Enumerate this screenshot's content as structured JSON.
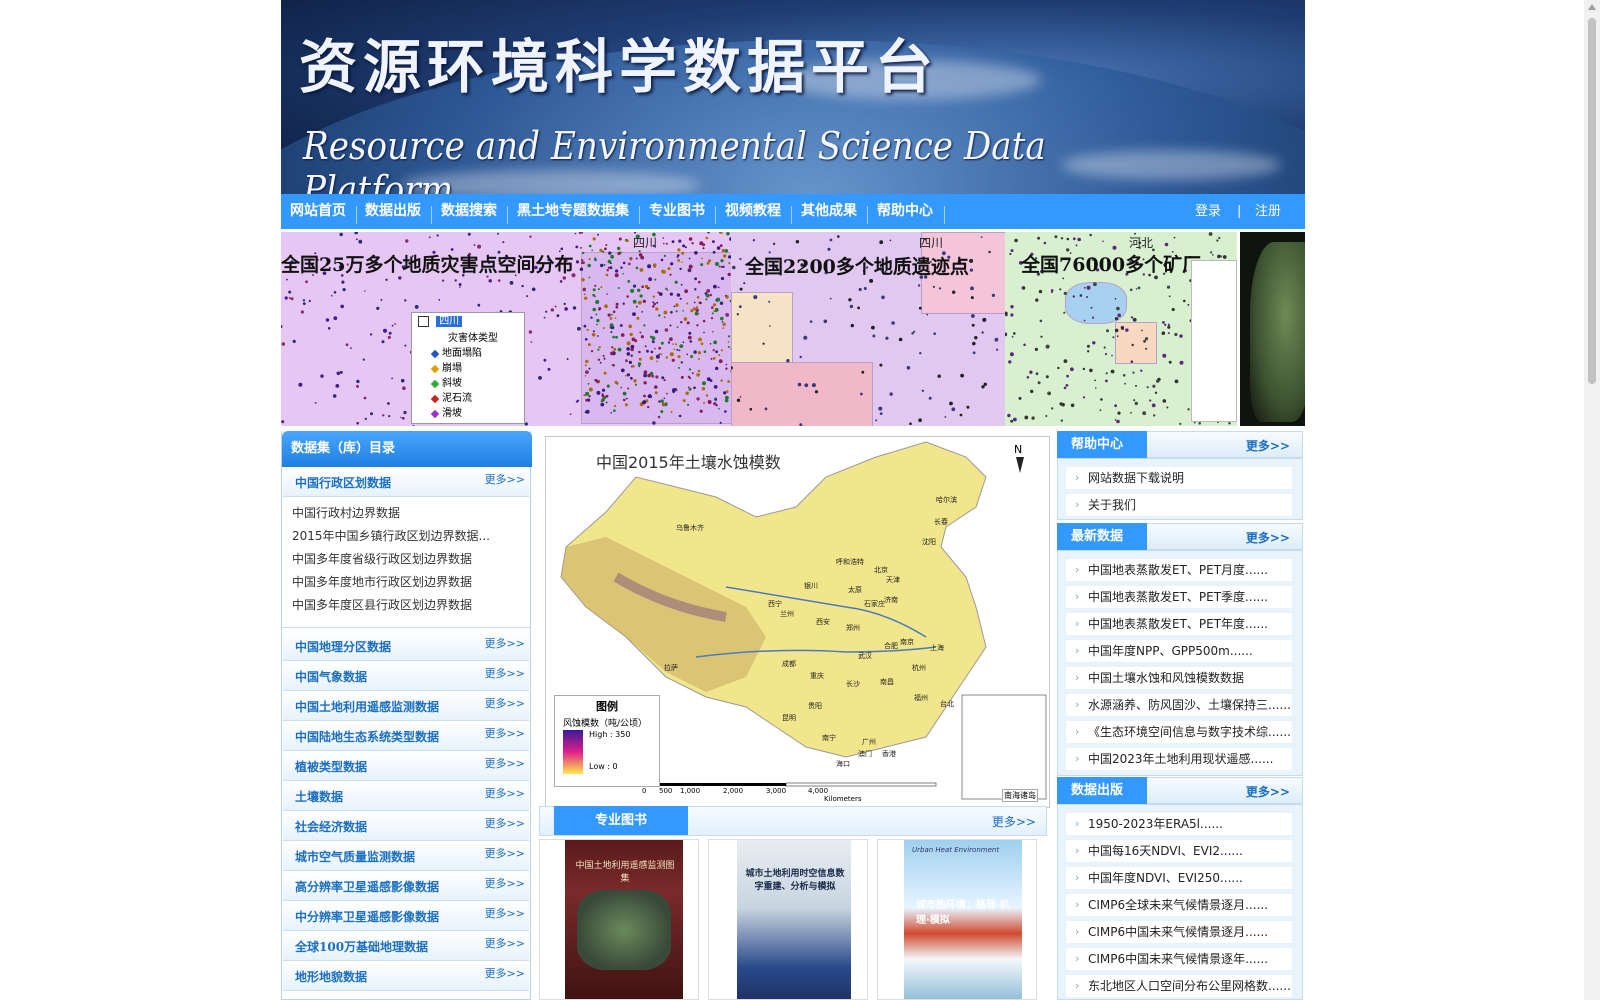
{
  "banner": {
    "title_cn": "资源环境科学数据平台",
    "title_en": "Resource and Environmental Science Data Platform"
  },
  "nav": {
    "items": [
      "网站首页",
      "数据出版",
      "数据搜索",
      "黑土地专题数据集",
      "专业图书",
      "视频教程",
      "其他成果",
      "帮助中心"
    ],
    "login": "登录",
    "divider": "|",
    "register": "注册"
  },
  "slider": {
    "slide1": {
      "title": "全国25万多个地质灾害点空间分布",
      "province": "四川",
      "legend_province": "四川",
      "legend_type": "灾害体类型",
      "legend_items": [
        "地面塌陷",
        "崩塌",
        "斜坡",
        "泥石流",
        "滑坡"
      ]
    },
    "slide2": {
      "title": "全国2200多个地质遗迹点",
      "province": "四川"
    },
    "slide3": {
      "title": "全国76000多个矿厂",
      "province": "河北"
    }
  },
  "left": {
    "header": "数据集（库）目录",
    "first_category": "中国行政区划数据",
    "more": "更多>>",
    "sub_items": [
      "中国行政村边界数据",
      "2015年中国乡镇行政区划边界数据...",
      "中国多年度省级行政区划边界数据",
      "中国多年度地市行政区划边界数据",
      "中国多年度区县行政区划边界数据"
    ],
    "categories": [
      "中国地理分区数据",
      "中国气象数据",
      "中国土地利用遥感监测数据",
      "中国陆地生态系统类型数据",
      "植被类型数据",
      "土壤数据",
      "社会经济数据",
      "城市空气质量监测数据",
      "高分辨率卫星遥感影像数据",
      "中分辨率卫星遥感影像数据",
      "全球100万基础地理数据",
      "地形地貌数据"
    ]
  },
  "center_map": {
    "title": "中国2015年土壤水蚀模数",
    "north": "N",
    "legend_title": "图例",
    "legend_label": "风蚀模数（吨/公顷）",
    "legend_high": "High : 350",
    "legend_low": "Low : 0",
    "scale_ticks": [
      "0",
      "500",
      "1,000",
      "2,000",
      "3,000",
      "4,000"
    ],
    "scale_unit": "Kilometers",
    "inset_label": "南海诸岛",
    "cities": [
      "哈尔滨",
      "长春",
      "沈阳",
      "乌鲁木齐",
      "呼和浩特",
      "北京",
      "天津",
      "银川",
      "太原",
      "石家庄",
      "济南",
      "西宁",
      "兰州",
      "郑州",
      "西安",
      "合肥",
      "南京",
      "上海",
      "成都",
      "武汉",
      "杭州",
      "重庆",
      "长沙",
      "南昌",
      "贵阳",
      "福州",
      "台北",
      "昆明",
      "南宁",
      "广州",
      "澳门",
      "香港",
      "海口",
      "拉萨"
    ]
  },
  "books": {
    "header": "专业图书",
    "more": "更多>>",
    "covers": [
      {
        "title": "中国土地利用遥感监测图集"
      },
      {
        "title": "城市土地利用时空信息数字重建、分析与模拟"
      },
      {
        "title": "城市热环境：格局·机理·模拟",
        "subtitle_en": "Urban Heat Environment"
      }
    ]
  },
  "right": {
    "help": {
      "title": "帮助中心",
      "more": "更多>>",
      "items": [
        "网站数据下载说明",
        "关于我们"
      ]
    },
    "latest": {
      "title": "最新数据",
      "more": "更多>>",
      "items": [
        "中国地表蒸散发ET、PET月度......",
        "中国地表蒸散发ET、PET季度......",
        "中国地表蒸散发ET、PET年度......",
        "中国年度NPP、GPP500m......",
        "中国土壤水蚀和风蚀模数数据",
        "水源涵养、防风固沙、土壤保持三......",
        "《生态环境空间信息与数字技术综......",
        "中国2023年土地利用现状遥感......"
      ]
    },
    "publish": {
      "title": "数据出版",
      "more": "更多>>",
      "items": [
        "1950-2023年ERA5l......",
        "中国每16天NDVI、EVI2......",
        "中国年度NDVI、EVI250......",
        "CIMP6全球未来气候情景逐月......",
        "CIMP6中国未来气候情景逐月......",
        "CIMP6中国未来气候情景逐年......",
        "东北地区人口空间分布公里网格数......"
      ]
    }
  },
  "colors": {
    "nav": "#3399ff",
    "link": "#1d6fbf",
    "panel_bg": "#e9f3fc"
  }
}
